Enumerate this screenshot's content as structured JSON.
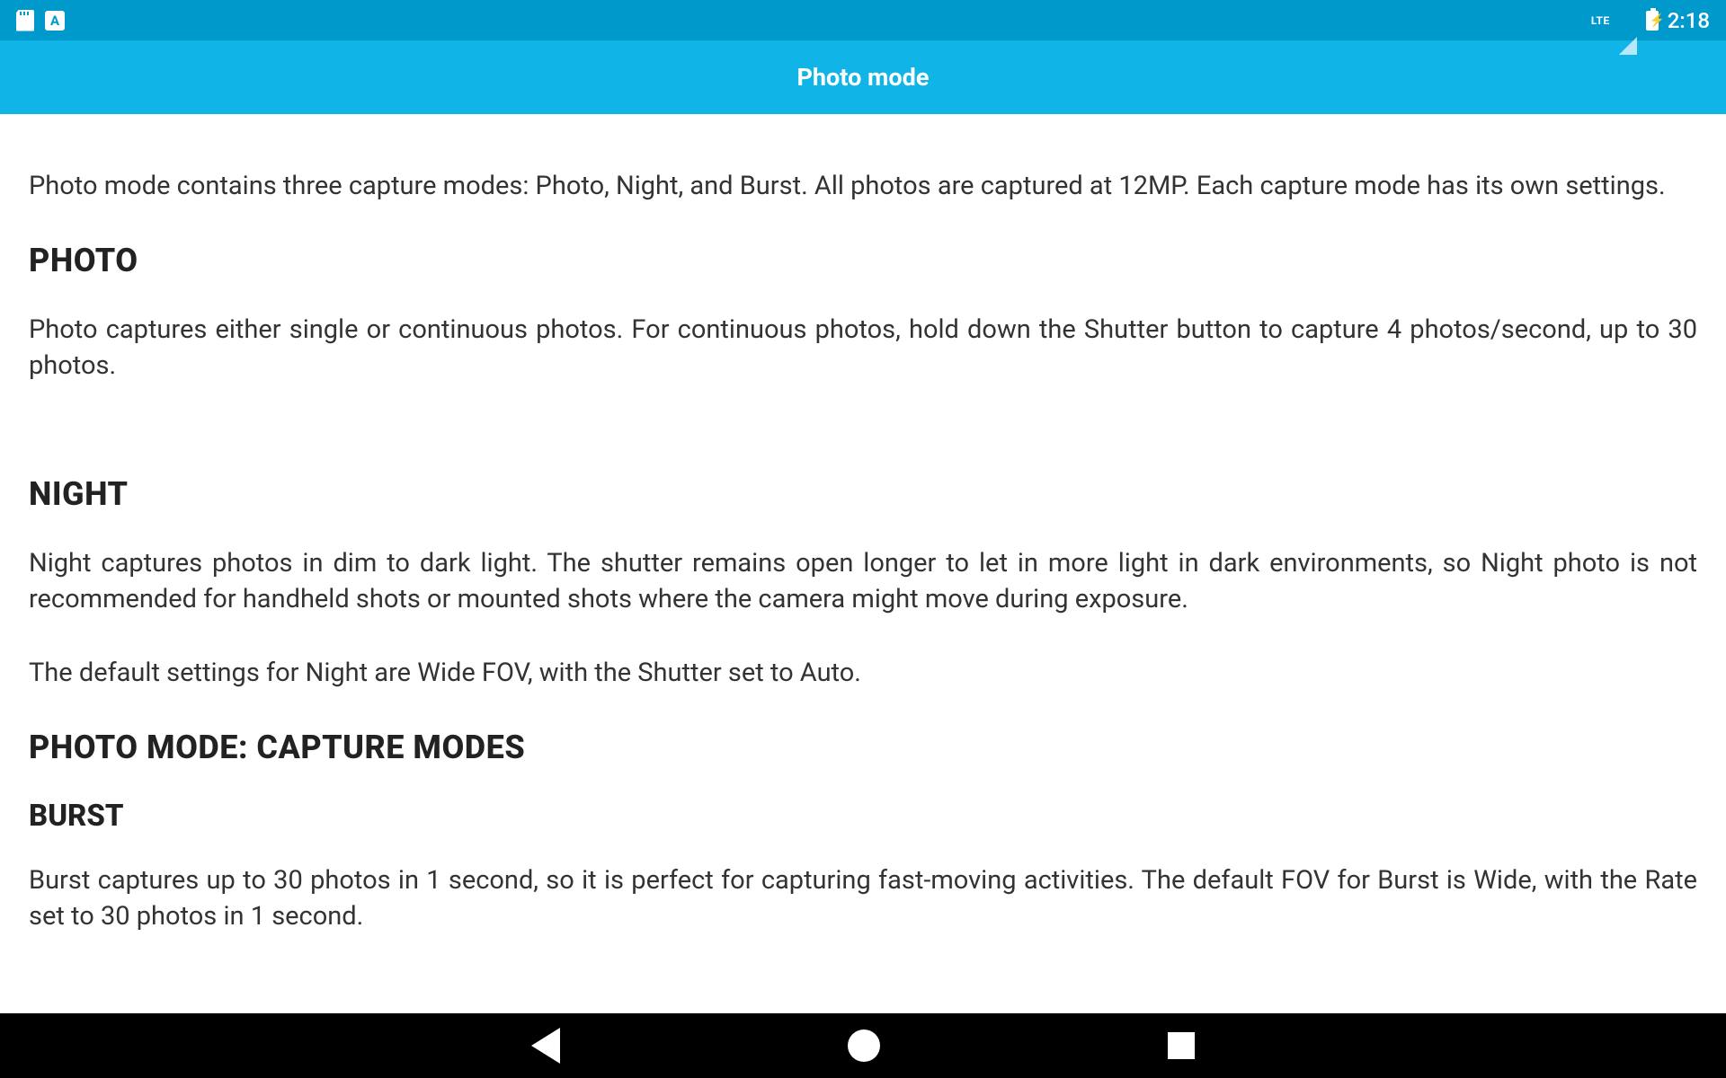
{
  "status": {
    "lte": "LTE",
    "time": "2:18",
    "a_label": "A"
  },
  "appbar": {
    "title": "Photo mode"
  },
  "content": {
    "intro": "Photo mode contains three capture modes: Photo, Night, and Burst. All photos are captured at 12MP. Each capture mode has its own settings.",
    "photo_heading": "PHOTO",
    "photo_body": "Photo captures either single or continuous photos. For continuous photos, hold down the Shutter button to capture 4 photos/second, up to 30 photos.",
    "night_heading": "NIGHT",
    "night_body1": "Night captures photos in dim to dark light. The shutter remains open longer to let in more light in dark environments, so Night photo is not recommended for handheld shots or mounted shots where the camera might move during exposure.",
    "night_body2": "The default settings for Night are Wide FOV, with the Shutter set to Auto.",
    "capture_heading": "PHOTO MODE: CAPTURE MODES",
    "burst_heading": "BURST",
    "burst_body": "Burst captures up to 30 photos in 1 second, so it is perfect for capturing fast-moving activities. The default FOV for Burst is Wide, with the Rate set to 30 photos in 1 second."
  }
}
